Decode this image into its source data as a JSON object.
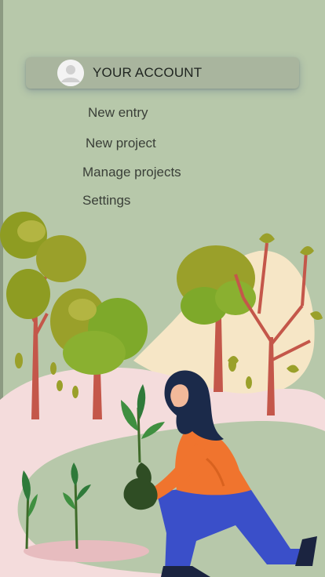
{
  "account": {
    "label": "YOUR ACCOUNT",
    "avatar_icon": "user-avatar-icon"
  },
  "menu": {
    "items": [
      {
        "label": "New entry"
      },
      {
        "label": "New project"
      },
      {
        "label": "Manage projects"
      },
      {
        "label": "Settings"
      }
    ]
  },
  "colors": {
    "background": "#b7c8aa",
    "card": "#a9b59e",
    "path": "#f4dcdc",
    "trunk": "#c4574a",
    "leaf": "#9aa02a",
    "shirt": "#f0742e",
    "pants": "#3a4fc9"
  }
}
